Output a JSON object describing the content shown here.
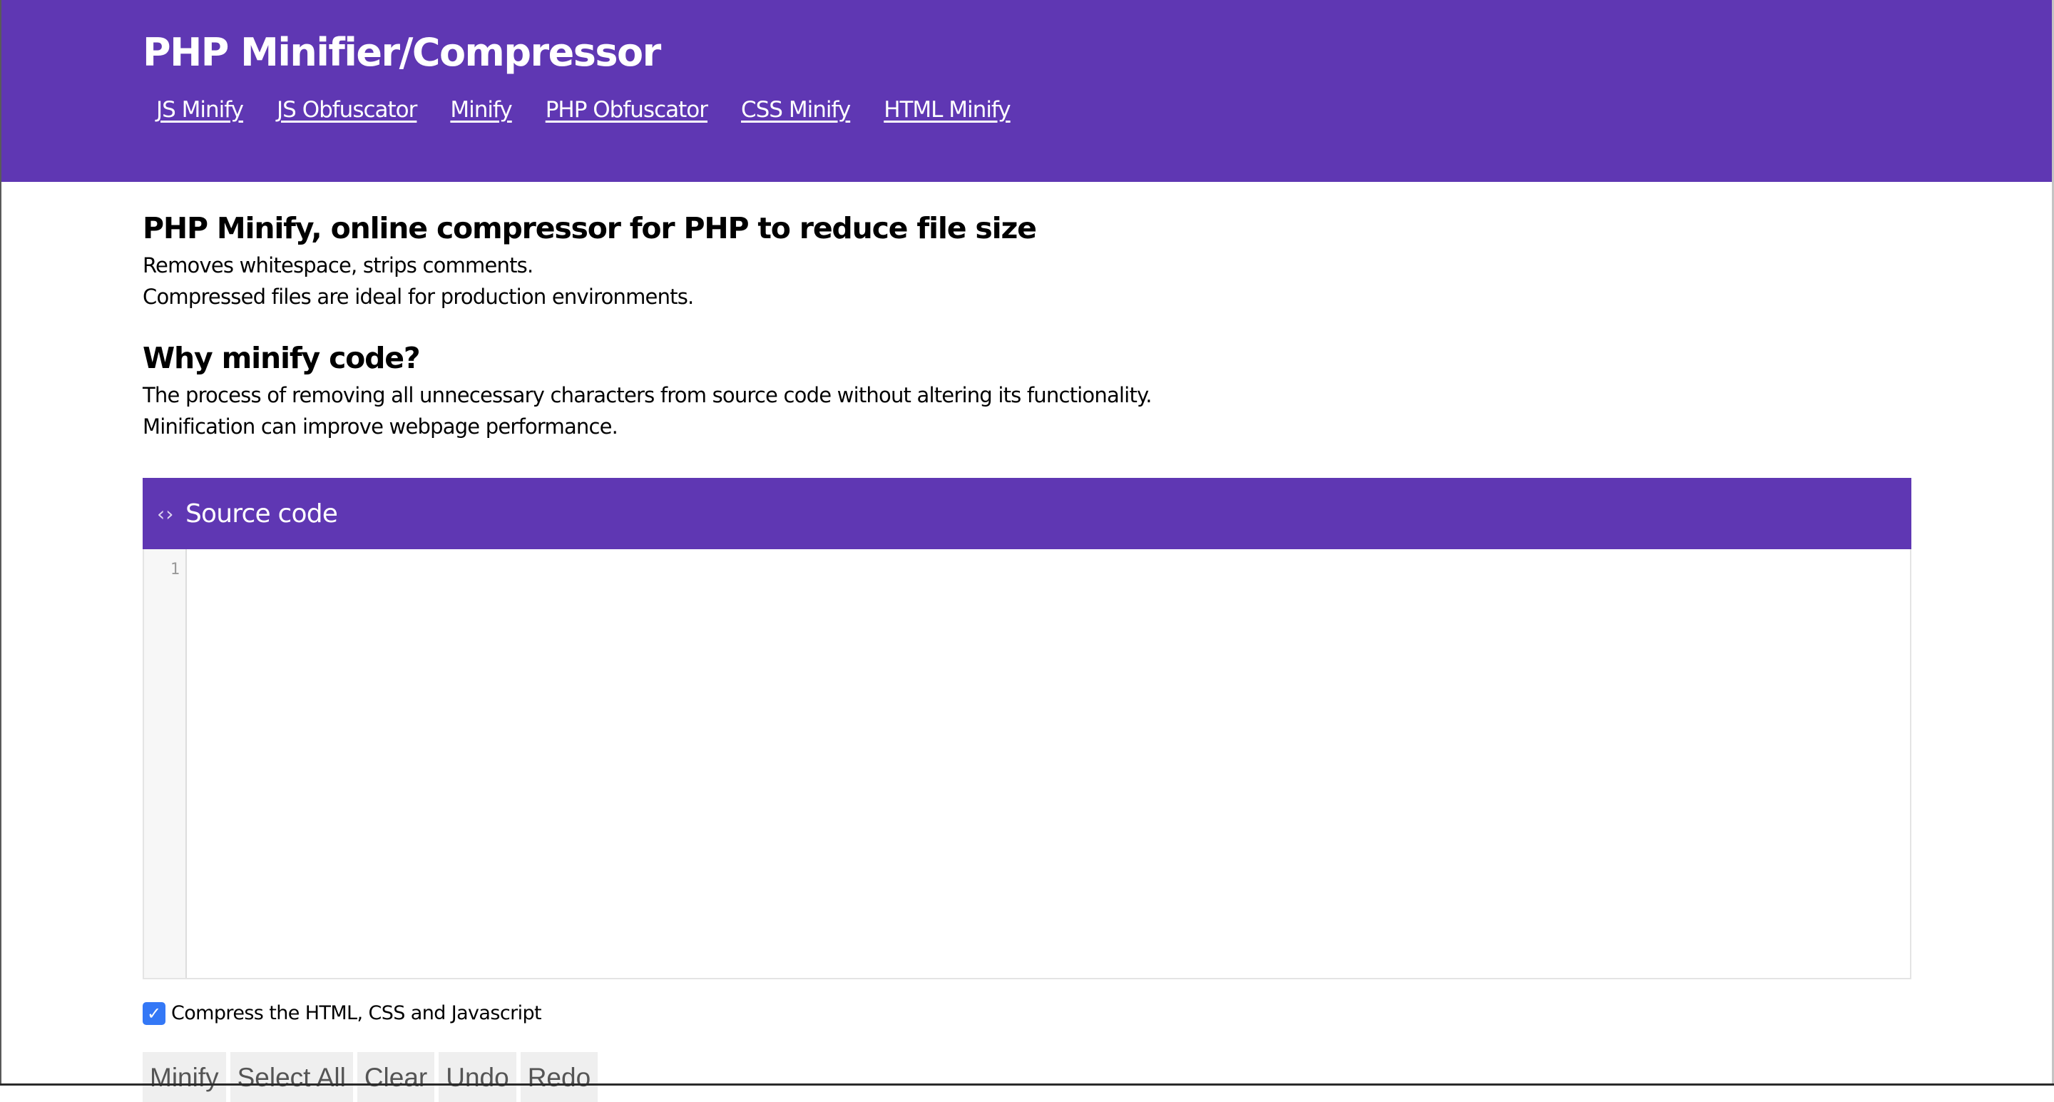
{
  "header": {
    "title": "PHP Minifier/Compressor",
    "nav": [
      {
        "label": "JS Minify"
      },
      {
        "label": "JS Obfuscator"
      },
      {
        "label": "Minify"
      },
      {
        "label": "PHP Obfuscator"
      },
      {
        "label": "CSS Minify"
      },
      {
        "label": "HTML Minify"
      }
    ]
  },
  "intro": {
    "heading": "PHP Minify, online compressor for PHP to reduce file size",
    "lines": [
      "Removes whitespace, strips comments.",
      "Compressed files are ideal for production environments."
    ]
  },
  "why": {
    "heading": "Why minify code?",
    "lines": [
      "The process of removing all unnecessary characters from source code without altering its functionality.",
      "Minification can improve webpage performance."
    ]
  },
  "editor": {
    "icon": "code-icon",
    "icon_glyph": "‹›",
    "title": "Source code",
    "line_numbers": [
      "1"
    ],
    "value": ""
  },
  "options": {
    "compress_checkbox": {
      "label": "Compress the HTML, CSS and Javascript",
      "checked": true,
      "check_glyph": "✓"
    }
  },
  "buttons": [
    {
      "label": "Minify"
    },
    {
      "label": "Select All"
    },
    {
      "label": "Clear"
    },
    {
      "label": "Undo"
    },
    {
      "label": "Redo"
    }
  ],
  "colors": {
    "brand": "#5f37b3",
    "checkbox": "#3478f6",
    "button_bg": "#efefef",
    "button_text": "#555555",
    "gutter_bg": "#f7f7f7"
  }
}
